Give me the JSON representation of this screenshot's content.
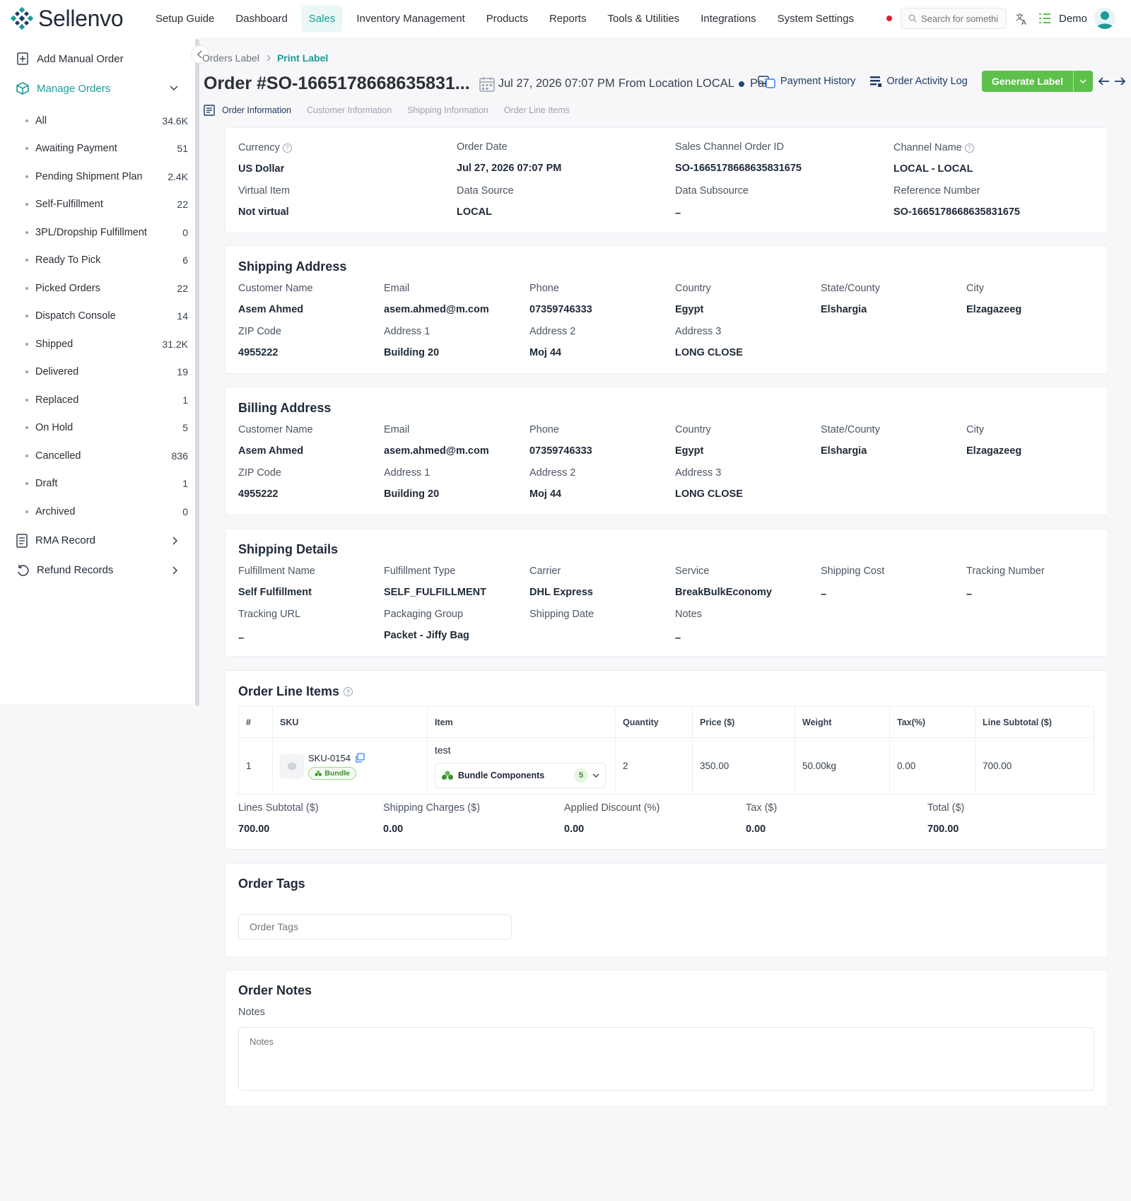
{
  "app": {
    "name": "Sellenvo",
    "colors": {
      "accent": "#1a9b96",
      "generate": "#5cc04a",
      "navy": "#1f3b63"
    }
  },
  "nav": {
    "items": [
      "Setup Guide",
      "Dashboard",
      "Sales",
      "Inventory Management",
      "Products",
      "Reports",
      "Tools & Utilities",
      "Integrations",
      "System Settings"
    ],
    "active": "Sales",
    "search_placeholder": "Search for something",
    "user": "Demo"
  },
  "sidebar": {
    "add_manual_order": "Add Manual Order",
    "manage_orders": "Manage Orders",
    "sub_items": [
      {
        "label": "All",
        "count": "34.6K"
      },
      {
        "label": "Awaiting Payment",
        "count": "51"
      },
      {
        "label": "Pending Shipment Plan",
        "count": "2.4K"
      },
      {
        "label": "Self-Fulfillment",
        "count": "22"
      },
      {
        "label": "3PL/Dropship Fulfillment",
        "count": "0"
      },
      {
        "label": "Ready To Pick",
        "count": "6"
      },
      {
        "label": "Picked Orders",
        "count": "22"
      },
      {
        "label": "Dispatch Console",
        "count": "14"
      },
      {
        "label": "Shipped",
        "count": "31.2K"
      },
      {
        "label": "Delivered",
        "count": "19"
      },
      {
        "label": "Replaced",
        "count": "1"
      },
      {
        "label": "On Hold",
        "count": "5"
      },
      {
        "label": "Cancelled",
        "count": "836"
      },
      {
        "label": "Draft",
        "count": "1"
      },
      {
        "label": "Archived",
        "count": "0"
      }
    ],
    "rma_record": "RMA Record",
    "refund_records": "Refund Records"
  },
  "breadcrumb": {
    "parent": "Orders Label",
    "current": "Print Label"
  },
  "order": {
    "title": "Order #SO-1665178668635831...",
    "date": "Jul 27, 2026 07:07 PM",
    "from_location": "From Location LOCAL",
    "status": "Paid"
  },
  "actions": {
    "payment_history": "Payment History",
    "activity_log": "Order Activity Log",
    "generate_label": "Generate Label"
  },
  "tabs": [
    "Order Information",
    "Customer Information",
    "Shipping Information",
    "Order Line Items"
  ],
  "order_info": {
    "currency_label": "Currency",
    "currency": "US Dollar",
    "order_date_label": "Order Date",
    "order_date": "Jul 27, 2026 07:07 PM",
    "sales_channel_label": "Sales Channel Order ID",
    "sales_channel_id": "SO-1665178668635831675",
    "channel_name_label": "Channel Name",
    "channel_name": "LOCAL - LOCAL",
    "virtual_label": "Virtual Item",
    "virtual": "Not virtual",
    "data_source_label": "Data Source",
    "data_source": "LOCAL",
    "data_subsource_label": "Data Subsource",
    "data_subsource": "–",
    "reference_label": "Reference Number",
    "reference": "SO-1665178668635831675"
  },
  "shipping_address": {
    "title": "Shipping Address",
    "labels": [
      "Customer Name",
      "Email",
      "Phone",
      "Country",
      "State/County",
      "City",
      "ZIP Code",
      "Address 1",
      "Address 2",
      "Address 3"
    ],
    "values": [
      "Asem Ahmed",
      "asem.ahmed@m.com",
      "07359746333",
      "Egypt",
      "Elshargia",
      "Elzagazeeg",
      "4955222",
      "Building 20",
      "Moj 44",
      "LONG CLOSE"
    ]
  },
  "billing_address": {
    "title": "Billing Address",
    "labels": [
      "Customer Name",
      "Email",
      "Phone",
      "Country",
      "State/County",
      "City",
      "ZIP Code",
      "Address 1",
      "Address 2",
      "Address 3"
    ],
    "values": [
      "Asem Ahmed",
      "asem.ahmed@m.com",
      "07359746333",
      "Egypt",
      "Elshargia",
      "Elzagazeeg",
      "4955222",
      "Building 20",
      "Moj 44",
      "LONG CLOSE"
    ]
  },
  "shipping_details": {
    "title": "Shipping Details",
    "labels": [
      "Fulfillment Name",
      "Fulfillment Type",
      "Carrier",
      "Service",
      "Shipping Cost",
      "Tracking Number",
      "Tracking URL",
      "Packaging Group",
      "Shipping Date",
      "Notes"
    ],
    "values": [
      "Self Fulfillment",
      "SELF_FULFILLMENT",
      "DHL Express",
      "BreakBulkEconomy",
      "–",
      "–",
      "–",
      "Packet - Jiffy Bag",
      "",
      "–"
    ]
  },
  "line_items": {
    "title": "Order Line Items",
    "headers": [
      "#",
      "SKU",
      "Item",
      "Quantity",
      "Price ($)",
      "Weight",
      "Tax(%)",
      "Line Subtotal ($)"
    ],
    "rows": [
      {
        "num": "1",
        "sku": "SKU-0154",
        "badge": "Bundle",
        "item": "test",
        "bundle_label": "Bundle Components",
        "bundle_count": "5",
        "quantity": "2",
        "price": "350.00",
        "weight": "50.00kg",
        "tax": "0.00",
        "subtotal": "700.00"
      }
    ],
    "totals_labels": [
      "Lines Subtotal ($)",
      "Shipping Charges ($)",
      "Applied Discount (%)",
      "Tax ($)",
      "Total ($)"
    ],
    "totals_values": [
      "700.00",
      "0.00",
      "0.00",
      "0.00",
      "700.00"
    ]
  },
  "order_tags": {
    "title": "Order Tags",
    "placeholder": "Order Tags"
  },
  "order_notes": {
    "title": "Order Notes",
    "label": "Notes",
    "placeholder": "Notes"
  }
}
